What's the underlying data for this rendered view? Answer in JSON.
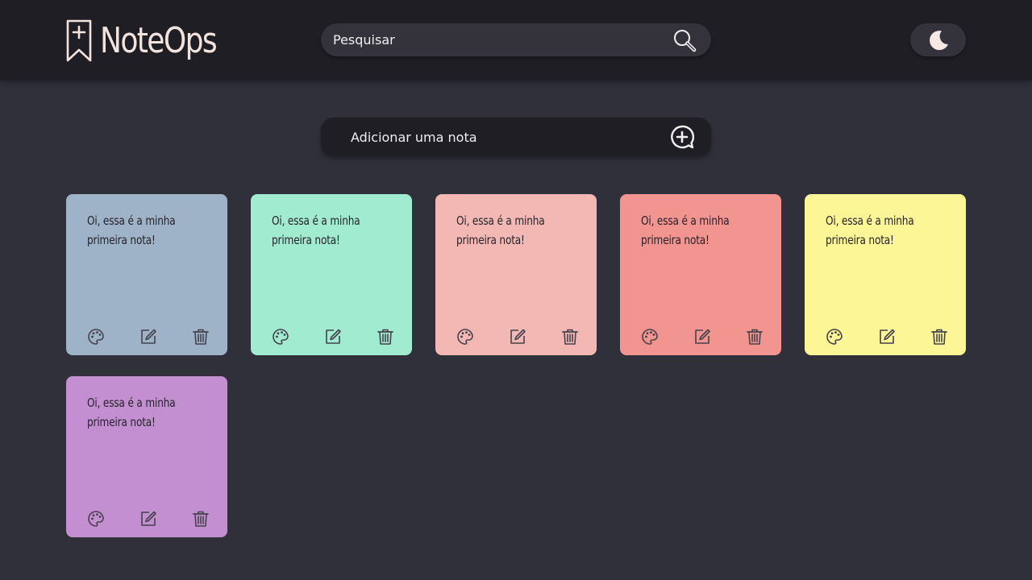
{
  "brand": {
    "name": "NoteOps"
  },
  "search": {
    "placeholder": "Pesquisar",
    "value": ""
  },
  "add_note": {
    "placeholder": "Adicionar uma nota",
    "value": ""
  },
  "colors": {
    "header_bg": "#1f1e24",
    "page_bg": "#30303a",
    "accent_text": "#f3e3de"
  },
  "notes": [
    {
      "text": "Oi, essa é a minha primeira nota!",
      "color": "#9eb3c8"
    },
    {
      "text": "Oi, essa é a minha primeira nota!",
      "color": "#a1ebd1"
    },
    {
      "text": "Oi, essa é a minha primeira nota!",
      "color": "#f3b8b3"
    },
    {
      "text": "Oi, essa é a minha primeira nota!",
      "color": "#f2948f"
    },
    {
      "text": "Oi, essa é a minha primeira nota!",
      "color": "#fdf697"
    },
    {
      "text": "Oi, essa é a minha primeira nota!",
      "color": "#c48fd1"
    }
  ],
  "icons": {
    "logo": "bookmark-plus-icon",
    "search": "search-icon",
    "theme": "moon-icon",
    "add": "add-circle-icon",
    "note_actions": [
      "palette-icon",
      "edit-icon",
      "trash-icon"
    ]
  }
}
